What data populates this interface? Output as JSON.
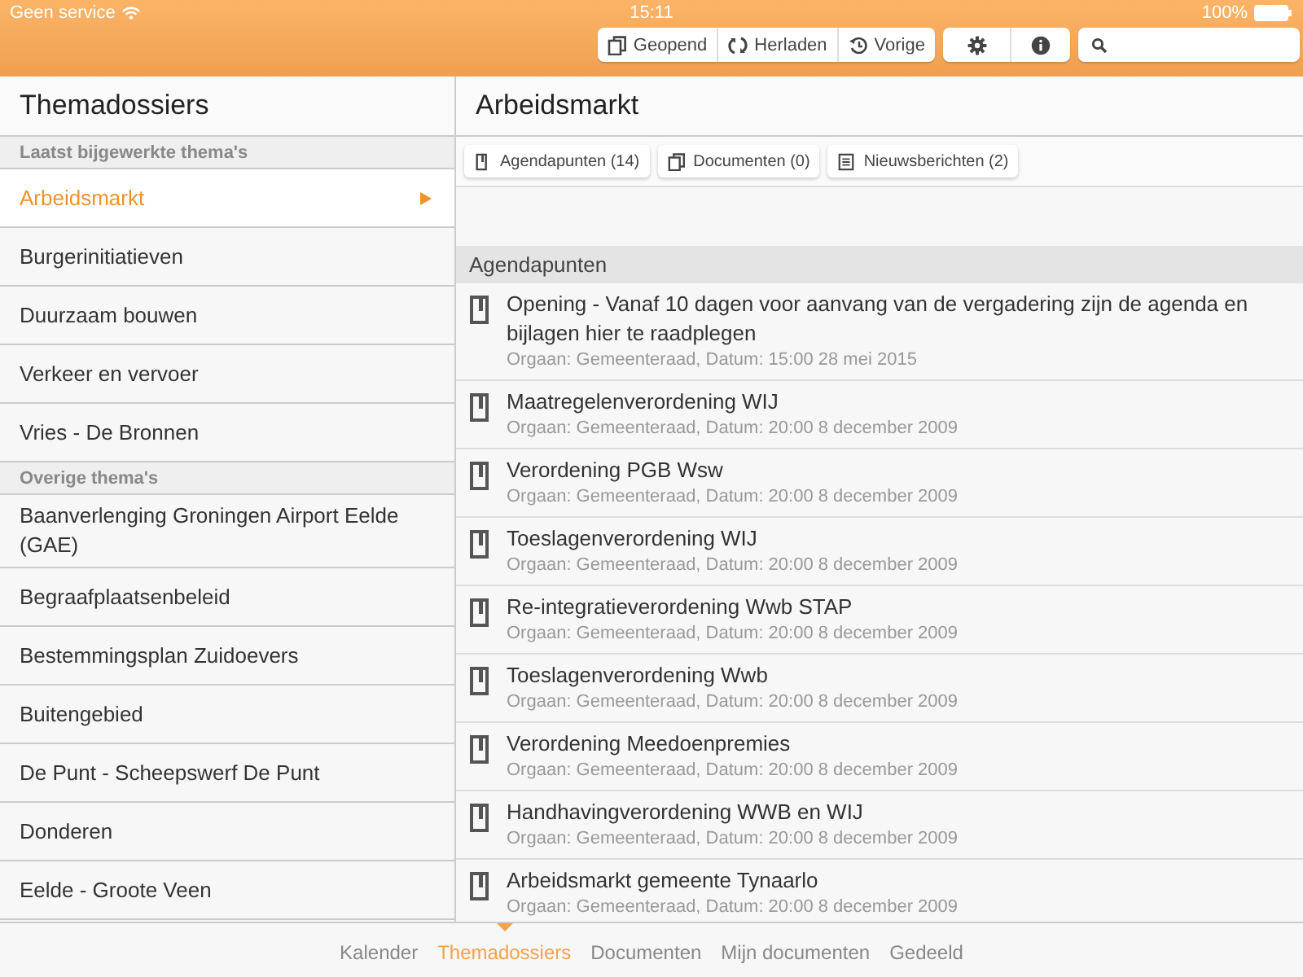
{
  "status_bar": {
    "carrier": "Geen service",
    "time": "15:11",
    "battery": "100%"
  },
  "toolbar": {
    "buttons": [
      {
        "kind": "copy",
        "label": "Geopend"
      },
      {
        "kind": "reload",
        "label": "Herladen"
      },
      {
        "kind": "history",
        "label": "Vorige"
      }
    ],
    "tools": [
      {
        "kind": "settings"
      },
      {
        "kind": "info"
      }
    ]
  },
  "sidebar": {
    "title": "Themadossiers",
    "sections": [
      {
        "title": "Laatst bijgewerkte thema's",
        "items": [
          {
            "label": "Arbeidsmarkt",
            "selected": true
          },
          {
            "label": "Burgerinitiatieven",
            "selected": false
          },
          {
            "label": "Duurzaam bouwen",
            "selected": false
          },
          {
            "label": "Verkeer en vervoer",
            "selected": false
          },
          {
            "label": "Vries - De Bronnen",
            "selected": false
          }
        ]
      },
      {
        "title": "Overige thema's",
        "items": [
          {
            "label": "Baanverlenging Groningen Airport Eelde (GAE)",
            "selected": false
          },
          {
            "label": "Begraafplaatsenbeleid",
            "selected": false
          },
          {
            "label": "Bestemmingsplan Zuidoevers",
            "selected": false
          },
          {
            "label": "Buitengebied",
            "selected": false
          },
          {
            "label": "De Punt - Scheepswerf De Punt",
            "selected": false
          },
          {
            "label": "Donderen",
            "selected": false
          },
          {
            "label": "Eelde - Groote Veen",
            "selected": false
          }
        ]
      }
    ]
  },
  "detail": {
    "title": "Arbeidsmarkt",
    "chips": [
      {
        "kind": "agenda",
        "label": "Agendapunten (14)"
      },
      {
        "kind": "copy",
        "label": "Documenten (0)"
      },
      {
        "kind": "news",
        "label": "Nieuwsberichten (2)"
      }
    ],
    "section": "Agendapunten",
    "items": [
      {
        "title": "Opening - Vanaf 10 dagen voor aanvang van de vergadering zijn de agenda en bijlagen hier te raadplegen",
        "meta": "Orgaan: Gemeenteraad, Datum: 15:00 28 mei 2015"
      },
      {
        "title": "Maatregelenverordening WIJ",
        "meta": "Orgaan: Gemeenteraad, Datum: 20:00 8 december 2009"
      },
      {
        "title": "Verordening PGB Wsw",
        "meta": "Orgaan: Gemeenteraad, Datum: 20:00 8 december 2009"
      },
      {
        "title": "Toeslagenverordening WIJ",
        "meta": "Orgaan: Gemeenteraad, Datum: 20:00 8 december 2009"
      },
      {
        "title": "Re-integratieverordening Wwb STAP",
        "meta": "Orgaan: Gemeenteraad, Datum: 20:00 8 december 2009"
      },
      {
        "title": "Toeslagenverordening Wwb",
        "meta": "Orgaan: Gemeenteraad, Datum: 20:00 8 december 2009"
      },
      {
        "title": "Verordening Meedoenpremies",
        "meta": "Orgaan: Gemeenteraad, Datum: 20:00 8 december 2009"
      },
      {
        "title": "Handhavingverordening WWB en WIJ",
        "meta": "Orgaan: Gemeenteraad, Datum: 20:00 8 december 2009"
      },
      {
        "title": "Arbeidsmarkt gemeente Tynaarlo",
        "meta": "Orgaan: Gemeenteraad, Datum: 20:00 8 december 2009"
      }
    ]
  },
  "tab_bar": [
    {
      "label": "Kalender",
      "selected": false
    },
    {
      "label": "Themadossiers",
      "selected": true
    },
    {
      "label": "Documenten",
      "selected": false
    },
    {
      "label": "Mijn documenten",
      "selected": false
    },
    {
      "label": "Gedeeld",
      "selected": false
    }
  ]
}
